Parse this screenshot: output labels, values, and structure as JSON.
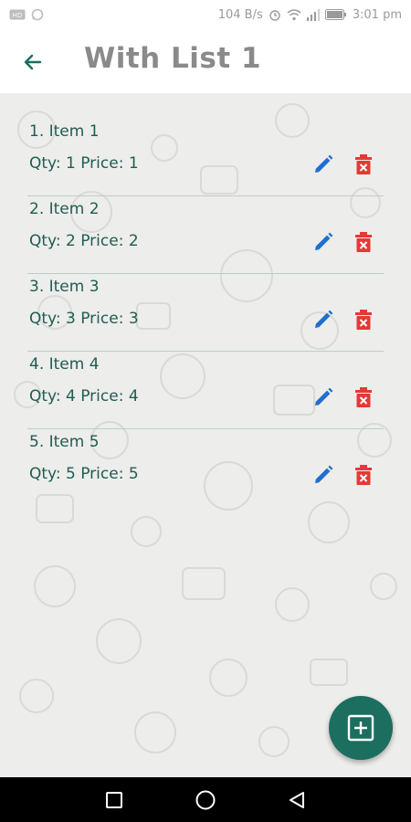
{
  "status_bar": {
    "speed": "104 B/s",
    "time": "3:01 pm",
    "icons": [
      "hd-icon",
      "whatsapp-icon",
      "alarm-icon",
      "wifi-icon",
      "signal-icon",
      "battery-icon"
    ]
  },
  "app_bar": {
    "title": "With List 1",
    "back_icon": "arrow-back-icon"
  },
  "items": [
    {
      "name": "1. Item 1",
      "meta": "Qty: 1 Price: 1"
    },
    {
      "name": "2. Item 2",
      "meta": "Qty: 2 Price: 2"
    },
    {
      "name": "3. Item 3",
      "meta": "Qty: 3 Price: 3"
    },
    {
      "name": "4. Item 4",
      "meta": "Qty: 4 Price: 4"
    },
    {
      "name": "5. Item 5",
      "meta": "Qty: 5 Price: 5"
    }
  ],
  "icons": {
    "edit": "pencil-icon",
    "delete": "delete-x-icon",
    "fab": "add-box-icon"
  },
  "colors": {
    "accent": "#1c6e5f",
    "text": "#1e5d52",
    "edit": "#1e6fd0",
    "delete": "#e53935"
  },
  "nav": [
    "recents-icon",
    "home-icon",
    "back-icon"
  ]
}
